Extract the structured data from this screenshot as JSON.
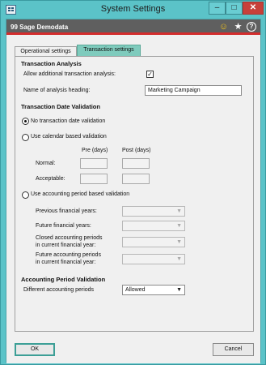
{
  "window": {
    "title": "System Settings",
    "controls": {
      "minimize": "–",
      "maximize": "□",
      "close": "✕"
    }
  },
  "app_bar": {
    "company": "99 Sage Demodata",
    "icons": [
      "smiley-icon",
      "star-icon",
      "help-icon"
    ],
    "help_glyph": "?"
  },
  "tabs": [
    {
      "label": "Operational settings",
      "active": false
    },
    {
      "label": "Transaction settings",
      "active": true
    }
  ],
  "transaction_analysis": {
    "heading": "Transaction Analysis",
    "allow_label": "Allow additional transaction analysis:",
    "allow_checked": true,
    "name_label": "Name of analysis heading:",
    "name_value": "Marketing Campaign"
  },
  "date_validation": {
    "heading": "Transaction Date Validation",
    "option_none": "No transaction date validation",
    "option_calendar": "Use calendar based validation",
    "col_pre": "Pre (days)",
    "col_post": "Post (days)",
    "row_normal": "Normal:",
    "row_acceptable": "Acceptable:",
    "option_period": "Use accounting period based validation",
    "prev_years": "Previous financial years:",
    "future_years": "Future financial years:",
    "closed_periods_1": "Closed accounting periods",
    "closed_periods_2": "in current financial year:",
    "future_periods_1": "Future accounting periods",
    "future_periods_2": "in current financial year:",
    "selected": "none"
  },
  "period_validation": {
    "heading": "Accounting Period Validation",
    "diff_label": "Different accounting periods",
    "diff_value": "Allowed"
  },
  "footer": {
    "ok_label": "OK",
    "cancel_label": "Cancel"
  },
  "colors": {
    "chrome": "#5bc3c8",
    "app_bar": "#5f5f5f",
    "accent_red": "#d32d2d",
    "active_tab": "#7fcbbd"
  }
}
